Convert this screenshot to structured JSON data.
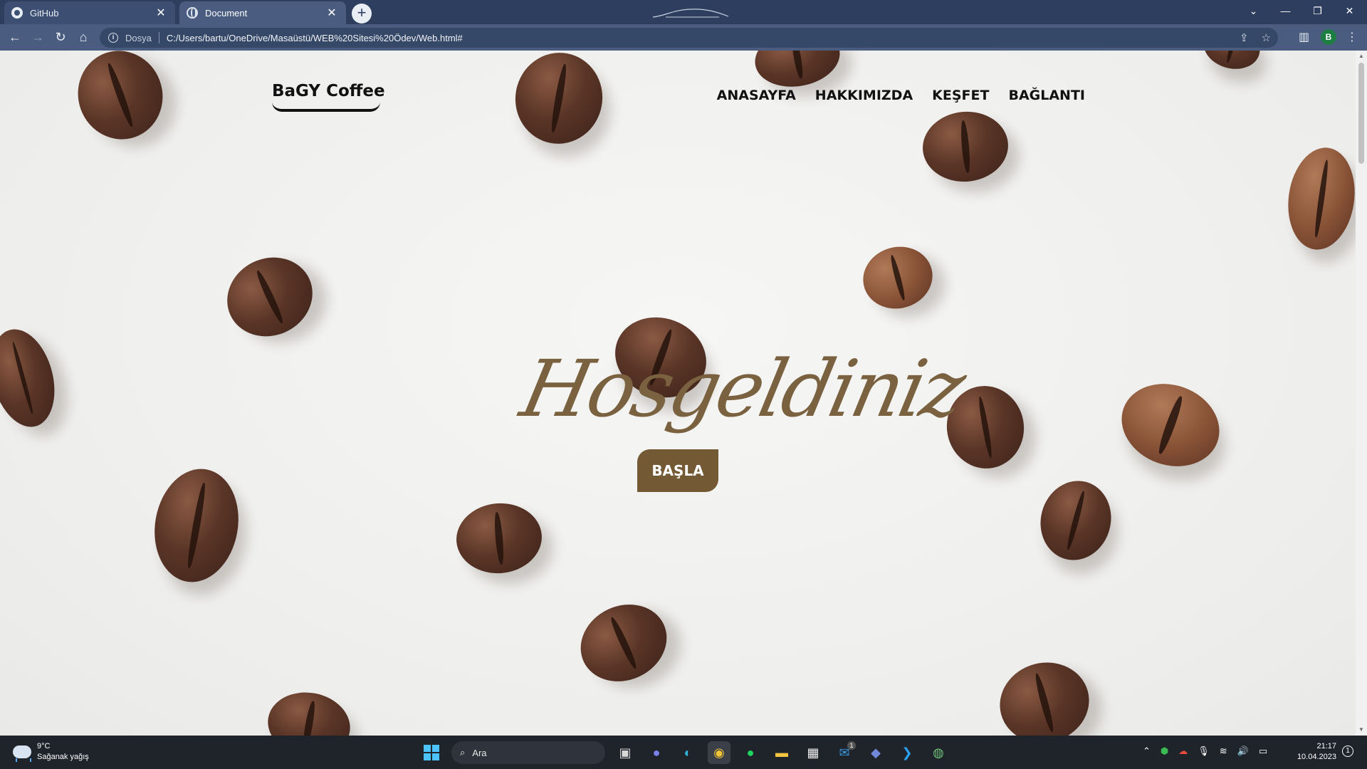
{
  "browser": {
    "tabs": [
      {
        "title": "GitHub",
        "icon": "github-icon",
        "active": false
      },
      {
        "title": "Document",
        "icon": "globe-icon",
        "active": true
      }
    ],
    "new_tab": "+",
    "address": {
      "scheme_label": "Dosya",
      "url": "C:/Users/bartu/OneDrive/Masaüstü/WEB%20Sitesi%20Ödev/Web.html#"
    },
    "profile_initial": "B",
    "window_controls": [
      "⌄",
      "—",
      "❐",
      "✕"
    ]
  },
  "page": {
    "logo": "BaGY Coffee",
    "nav": [
      "ANASAYFA",
      "HAKKIMIZDA",
      "KEŞFET",
      "BAĞLANTI"
    ],
    "hero_title": "Hosgeldiniz",
    "cta_label": "BAŞLA",
    "colors": {
      "accent": "#735a34",
      "script": "#7a6240",
      "text": "#111111"
    }
  },
  "taskbar": {
    "weather": {
      "temp": "9°C",
      "condition": "Sağanak yağış"
    },
    "search_placeholder": "Ara",
    "clock": {
      "time": "21:17",
      "date": "10.04.2023"
    },
    "mail_badge": "1",
    "notification_count": "1"
  }
}
